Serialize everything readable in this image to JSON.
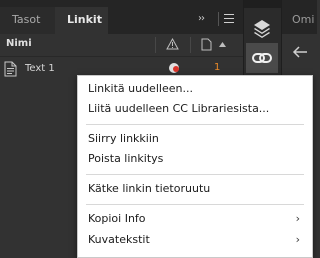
{
  "links_panel": {
    "tabs": [
      {
        "label": "Tasot"
      },
      {
        "label": "Linkit"
      }
    ],
    "more_glyph": "››",
    "header": {
      "name_column": "Nimi"
    },
    "rows": [
      {
        "name": "Text 1",
        "page": "1",
        "status_icon": "link-status-icon"
      }
    ]
  },
  "right_panel": {
    "tab_label": "Omi"
  },
  "context_menu": {
    "items": [
      {
        "label": "Linkitä uudelleen..."
      },
      {
        "label": "Liitä uudelleen CC Librariesista..."
      },
      {
        "label": "Siirry linkkiin"
      },
      {
        "label": "Poista linkitys"
      },
      {
        "label": "Kätke linkin tietoruutu"
      },
      {
        "label": "Kopioi Info",
        "submenu": true
      },
      {
        "label": "Kuvatekstit",
        "submenu": true
      }
    ],
    "submenu_glyph": "›"
  },
  "colors": {
    "panel_bg": "#323232",
    "menu_bg": "#ffffff",
    "page_number": "#e88a2a"
  }
}
